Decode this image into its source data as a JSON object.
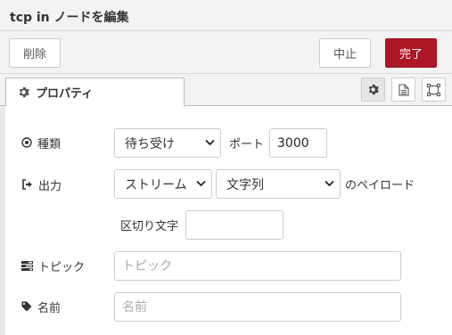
{
  "dialog": {
    "title": "tcp in ノードを編集"
  },
  "actions": {
    "delete_label": "削除",
    "cancel_label": "中止",
    "done_label": "完了"
  },
  "tabs": [
    {
      "label": "プロパティ",
      "icon": "gear-icon"
    }
  ],
  "tools": [
    {
      "icon": "gear-icon",
      "active": true
    },
    {
      "icon": "document-icon",
      "active": false
    },
    {
      "icon": "frame-icon",
      "active": false
    }
  ],
  "form": {
    "type": {
      "label": "種類",
      "icon": "target-icon",
      "value": "待ち受け",
      "port_label": "ポート",
      "port_value": "3000"
    },
    "output": {
      "label": "出力",
      "icon": "sign-out-icon",
      "mode_value": "ストリーム",
      "format_value": "文字列",
      "suffix": "のペイロード"
    },
    "delimiter": {
      "label": "区切り文字",
      "value": ""
    },
    "topic": {
      "label": "トピック",
      "icon": "tasks-icon",
      "placeholder": "トピック",
      "value": ""
    },
    "name": {
      "label": "名前",
      "icon": "tag-icon",
      "placeholder": "名前",
      "value": ""
    }
  },
  "colors": {
    "primary": "#ad1625",
    "toolbar_bg": "#f3f3f3",
    "border": "#cccccc"
  }
}
